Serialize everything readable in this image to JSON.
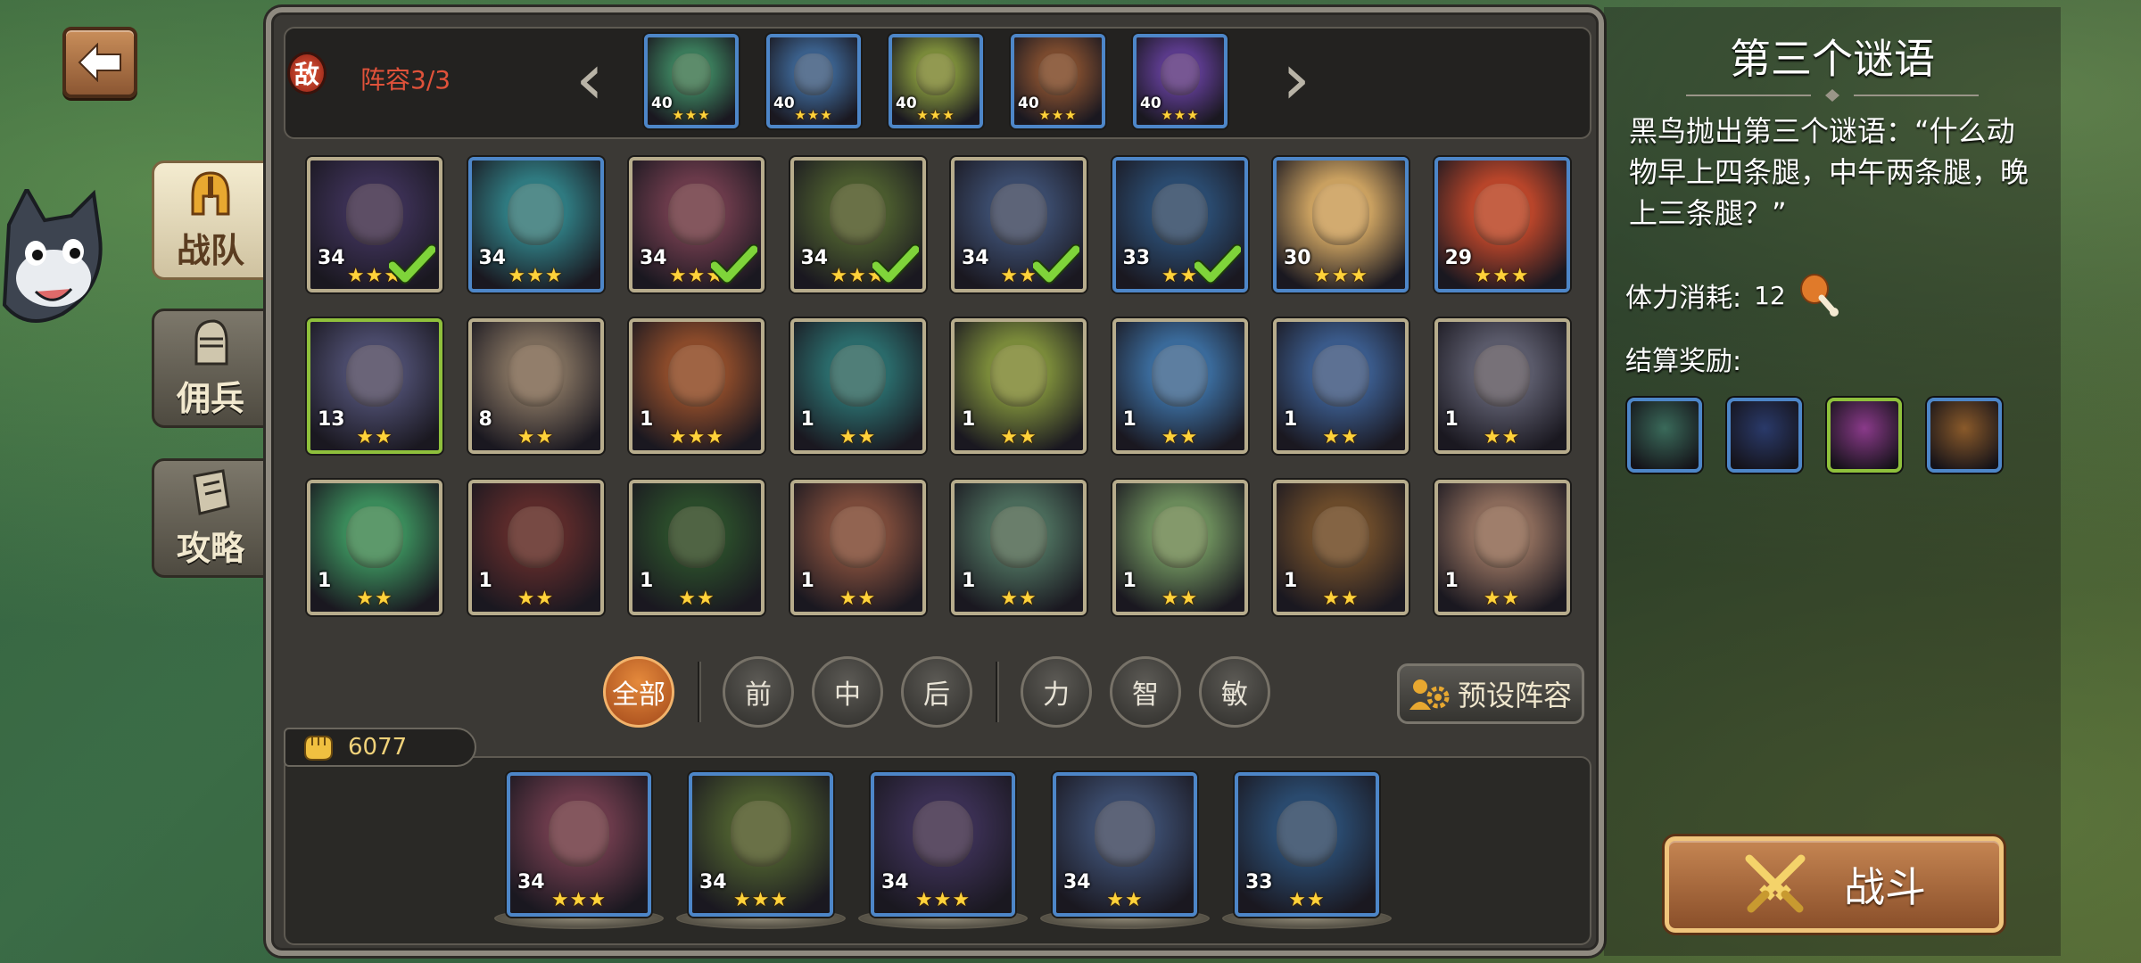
{
  "colors": {
    "accent": "#d9793a",
    "enemy": "#e0523a",
    "star": "#ffd23a",
    "frame": "#b7ac8c"
  },
  "back_button": {
    "icon": "back-arrow-icon"
  },
  "side_tabs": [
    {
      "label": "战队",
      "icon": "helmet-icon",
      "active": true
    },
    {
      "label": "佣兵",
      "icon": "knight-helmet-icon",
      "active": false
    },
    {
      "label": "攻略",
      "icon": "book-icon",
      "active": false
    }
  ],
  "enemy": {
    "badge": "敌",
    "count": "阵容3/3",
    "heroes": [
      {
        "level": "40",
        "stars": 3,
        "color": "#3a7a5a"
      },
      {
        "level": "40",
        "stars": 3,
        "color": "#3a5f8a"
      },
      {
        "level": "40",
        "stars": 3,
        "color": "#7a8a3a"
      },
      {
        "level": "40",
        "stars": 3,
        "color": "#7a4a2e"
      },
      {
        "level": "40",
        "stars": 3,
        "color": "#5a3a8a"
      }
    ]
  },
  "roster": [
    {
      "level": "34",
      "stars": 3,
      "selected": true,
      "frame": "",
      "color": "#3a2f52"
    },
    {
      "level": "34",
      "stars": 3,
      "selected": false,
      "frame": "blue",
      "color": "#2f7a80"
    },
    {
      "level": "34",
      "stars": 3,
      "selected": true,
      "frame": "",
      "color": "#6a3a4a"
    },
    {
      "level": "34",
      "stars": 3,
      "selected": true,
      "frame": "",
      "color": "#4a5a2e"
    },
    {
      "level": "34",
      "stars": 2,
      "selected": true,
      "frame": "",
      "color": "#3a4a6a"
    },
    {
      "level": "33",
      "stars": 2,
      "selected": true,
      "frame": "blue",
      "color": "#2a4a6e"
    },
    {
      "level": "30",
      "stars": 3,
      "selected": false,
      "frame": "blue",
      "color": "#c9a060"
    },
    {
      "level": "29",
      "stars": 3,
      "selected": false,
      "frame": "blue",
      "color": "#b8452a"
    },
    {
      "level": "13",
      "stars": 2,
      "selected": false,
      "frame": "green",
      "color": "#4a4a6a"
    },
    {
      "level": "8",
      "stars": 2,
      "selected": false,
      "frame": "",
      "color": "#7a6a5a"
    },
    {
      "level": "1",
      "stars": 3,
      "selected": false,
      "frame": "",
      "color": "#8a4a2a"
    },
    {
      "level": "1",
      "stars": 2,
      "selected": false,
      "frame": "",
      "color": "#2a6a6a"
    },
    {
      "level": "1",
      "stars": 2,
      "selected": false,
      "frame": "",
      "color": "#7a8a3a"
    },
    {
      "level": "1",
      "stars": 2,
      "selected": false,
      "frame": "",
      "color": "#3a6a9a"
    },
    {
      "level": "1",
      "stars": 2,
      "selected": false,
      "frame": "",
      "color": "#3a5a8a"
    },
    {
      "level": "1",
      "stars": 2,
      "selected": false,
      "frame": "",
      "color": "#5a5a6a"
    },
    {
      "level": "1",
      "stars": 2,
      "selected": false,
      "frame": "",
      "color": "#3a8a5a"
    },
    {
      "level": "1",
      "stars": 2,
      "selected": false,
      "frame": "",
      "color": "#5a2a2a"
    },
    {
      "level": "1",
      "stars": 2,
      "selected": false,
      "frame": "",
      "color": "#2a4a2a"
    },
    {
      "level": "1",
      "stars": 2,
      "selected": false,
      "frame": "",
      "color": "#7a4a3a"
    },
    {
      "level": "1",
      "stars": 2,
      "selected": false,
      "frame": "",
      "color": "#4a6a5a"
    },
    {
      "level": "1",
      "stars": 2,
      "selected": false,
      "frame": "",
      "color": "#6a8a5a"
    },
    {
      "level": "1",
      "stars": 2,
      "selected": false,
      "frame": "",
      "color": "#6a4a2a"
    },
    {
      "level": "1",
      "stars": 2,
      "selected": false,
      "frame": "",
      "color": "#8a6a5a"
    }
  ],
  "filters": {
    "all": "全部",
    "positions": [
      "前",
      "中",
      "后"
    ],
    "attributes": [
      "力",
      "智",
      "敏"
    ]
  },
  "preset_button": "预设阵容",
  "power": {
    "value": "6077",
    "icon": "fist-icon"
  },
  "team": [
    {
      "level": "34",
      "stars": 3,
      "color": "#6a3a4a"
    },
    {
      "level": "34",
      "stars": 3,
      "color": "#4a5a2e"
    },
    {
      "level": "34",
      "stars": 3,
      "color": "#3a2f52"
    },
    {
      "level": "34",
      "stars": 2,
      "color": "#3a4a6a"
    },
    {
      "level": "33",
      "stars": 2,
      "color": "#2a4a6e"
    }
  ],
  "quest": {
    "title": "第三个谜语",
    "description": "黑鸟抛出第三个谜语：“什么动物早上四条腿，中午两条腿，晚上三条腿？”",
    "stamina_label": "体力消耗:",
    "stamina_value": "12",
    "stamina_icon": "drumstick-icon",
    "reward_label": "结算奖励:",
    "rewards": [
      {
        "icon": "orc-hero-reward-icon",
        "color": "#3a6a5a",
        "frame": "#4d86c8"
      },
      {
        "icon": "hammer-reward-icon",
        "color": "#2a3a6a",
        "frame": "#4d86c8"
      },
      {
        "icon": "scroll-reward-icon",
        "color": "#8a3a8a",
        "frame": "#8fc03c"
      },
      {
        "icon": "axe-reward-icon",
        "color": "#8a5a2a",
        "frame": "#4d86c8"
      }
    ]
  },
  "fight_button": {
    "label": "战斗",
    "icon": "crossed-swords-icon"
  }
}
